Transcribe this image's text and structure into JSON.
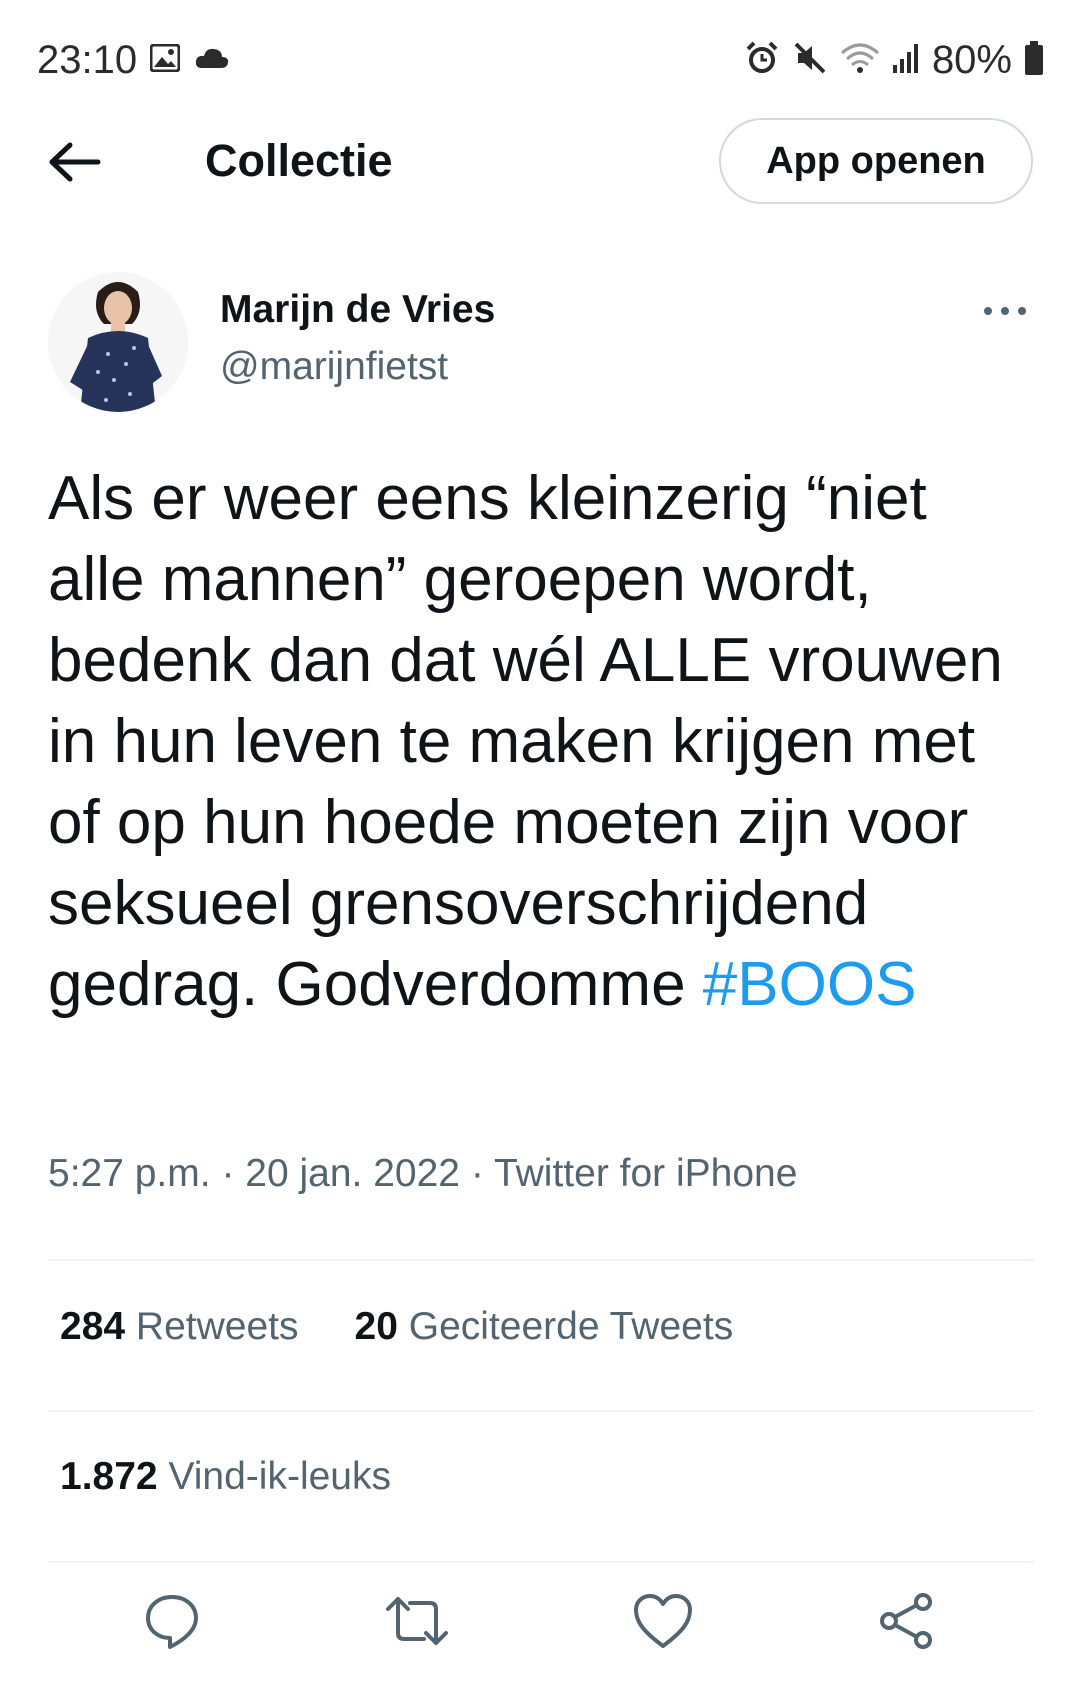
{
  "status_bar": {
    "time": "23:10",
    "left_icons": [
      "image-icon",
      "cloud-icon"
    ],
    "right_icons": [
      "alarm-icon",
      "mute-icon",
      "wifi-icon",
      "signal-icon",
      "battery-icon"
    ],
    "battery": "80%"
  },
  "header": {
    "title": "Collectie",
    "app_button": "App openen",
    "back_icon": "arrow-left-icon"
  },
  "tweet": {
    "author_name": "Marijn de Vries",
    "author_handle": "@marijnfietst",
    "text": "Als er weer eens kleinzerig “niet alle mannen” geroepen wordt, bedenk dan dat wél ALLE vrouwen in hun leven te maken krijgen met of op hun hoede moeten zijn voor seksueel grensoverschrijdend gedrag. Godverdomme ",
    "hashtag": "#BOOS",
    "time": "5:27 p.m.",
    "separator": "·",
    "date": "20 jan. 2022",
    "source": "Twitter for iPhone"
  },
  "stats": {
    "retweets_count": "284",
    "retweets_label": "Retweets",
    "quotes_count": "20",
    "quotes_label": "Geciteerde Tweets",
    "likes_count": "1.872",
    "likes_label": "Vind-ik-leuks"
  },
  "actions": [
    "reply-icon",
    "retweet-icon",
    "like-icon",
    "share-icon"
  ],
  "colors": {
    "text": "#0f1419",
    "secondary": "#536471",
    "accent": "#1d9bf0",
    "divider": "#eff3f4",
    "button_border": "#cfd9de"
  }
}
